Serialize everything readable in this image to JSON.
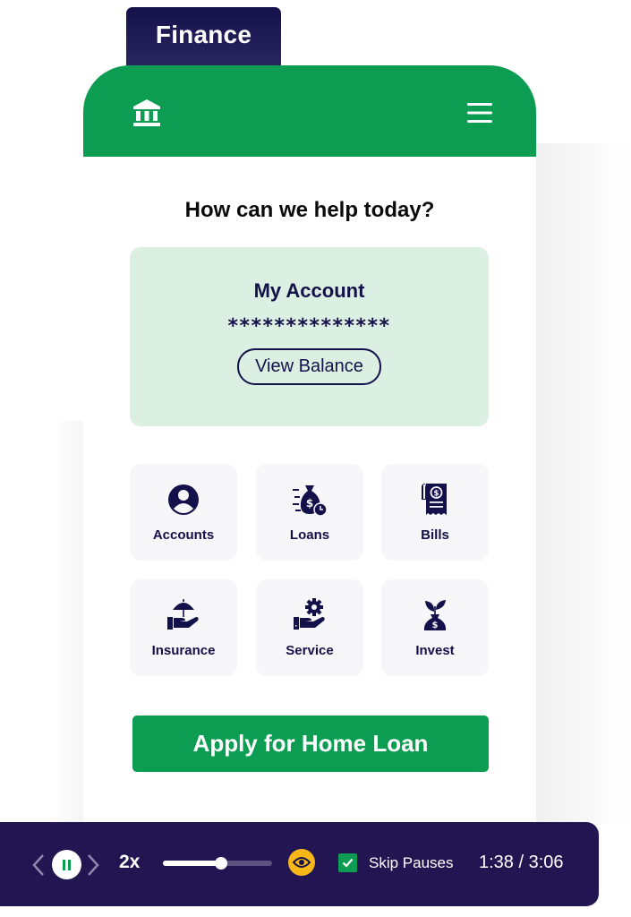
{
  "category_tab": {
    "label": "Finance"
  },
  "header": {
    "logo_icon": "bank-icon",
    "menu_icon": "hamburger-menu-icon",
    "brand_color": "#0c9c52"
  },
  "main": {
    "title": "How can we help today?",
    "account_card": {
      "title": "My Account",
      "masked_balance": "**************",
      "button_label": "View Balance"
    },
    "tiles": [
      {
        "label": "Accounts",
        "icon": "user-circle-icon"
      },
      {
        "label": "Loans",
        "icon": "money-bag-clock-icon"
      },
      {
        "label": "Bills",
        "icon": "receipt-icon"
      },
      {
        "label": "Insurance",
        "icon": "hand-umbrella-icon"
      },
      {
        "label": "Service",
        "icon": "hand-gear-icon"
      },
      {
        "label": "Invest",
        "icon": "money-bag-plant-icon"
      }
    ],
    "apply_button": "Apply for Home Loan"
  },
  "player": {
    "speed": "2x",
    "progress": 0.53,
    "skip_pauses_label": "Skip Pauses",
    "skip_pauses_checked": true,
    "current_time": "1:38",
    "total_time": "3:06",
    "time_display": "1:38 / 3:06",
    "colors": {
      "background": "#231551",
      "accent": "#f7b718"
    }
  }
}
